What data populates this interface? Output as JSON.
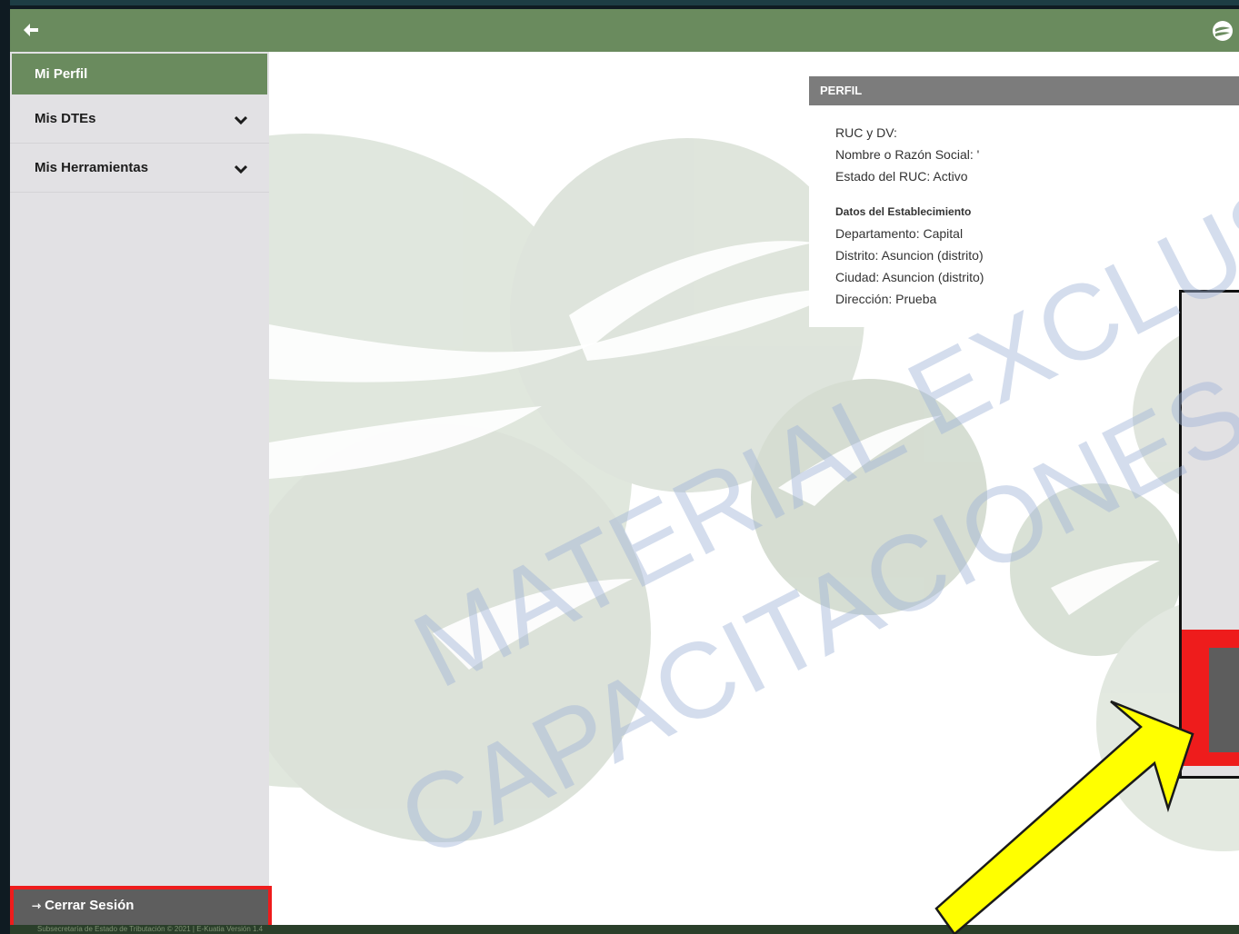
{
  "header": {
    "back_icon": "arrow-left-icon",
    "logo_icon": "set-logo-icon"
  },
  "sidebar": {
    "items": [
      {
        "label": "Mi Perfil",
        "active": true
      },
      {
        "label": "Mis DTEs",
        "has_chevron": true
      },
      {
        "label": "Mis Herramientas",
        "has_chevron": true
      }
    ],
    "logout_label": "Cerrar Sesión",
    "logout_icon": "sign-out-icon"
  },
  "profile": {
    "title": "PERFIL",
    "ruc": "RUC y DV:",
    "nombre": "Nombre o Razón Social: '",
    "estado": "Estado del RUC: Activo",
    "establecimiento_title": "Datos del Establecimiento",
    "departamento": "Departamento: Capital",
    "distrito": "Distrito: Asuncion (distrito)",
    "ciudad": "Ciudad: Asuncion (distrito)",
    "direccion": "Dirección: Prueba"
  },
  "footer": {
    "text": "Subsecretaría de Estado de Tributación © 2021 | E-Kuatia Versión 1.4"
  },
  "watermark": {
    "line1": "MATERIAL EXCLUSIVO",
    "line2": "CAPACITACIONES GRATUITAS"
  },
  "colors": {
    "header_green": "#6a8b5e",
    "sidebar_bg": "#e2e1e4",
    "highlight_red": "#ee1c1c",
    "arrow_yellow": "#ffff00"
  }
}
